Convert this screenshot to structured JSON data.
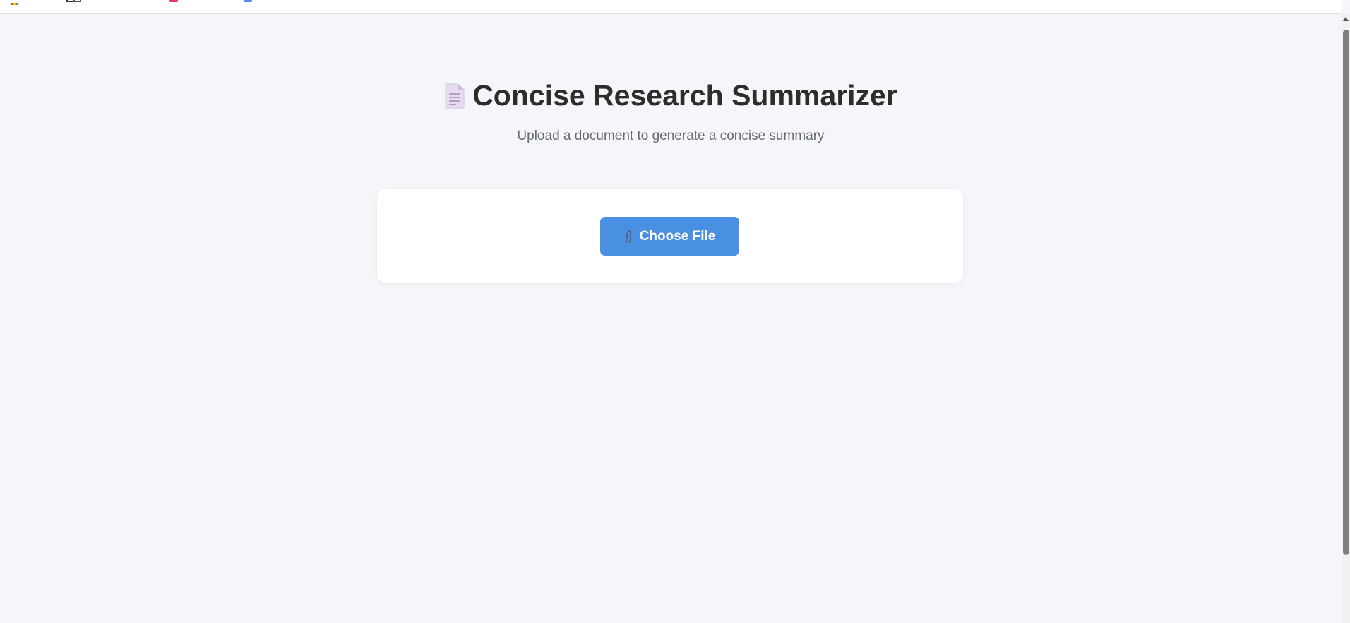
{
  "header": {
    "title": "Concise Research Summarizer",
    "subtitle": "Upload a document to generate a concise summary",
    "icon": "document-icon"
  },
  "upload": {
    "button_label": "Choose File",
    "button_icon": "paperclip-icon",
    "button_color": "#4a90e2"
  },
  "colors": {
    "background": "#f4f6fa",
    "card": "#ffffff",
    "title": "#2d2d2d",
    "subtitle": "#666a70"
  }
}
